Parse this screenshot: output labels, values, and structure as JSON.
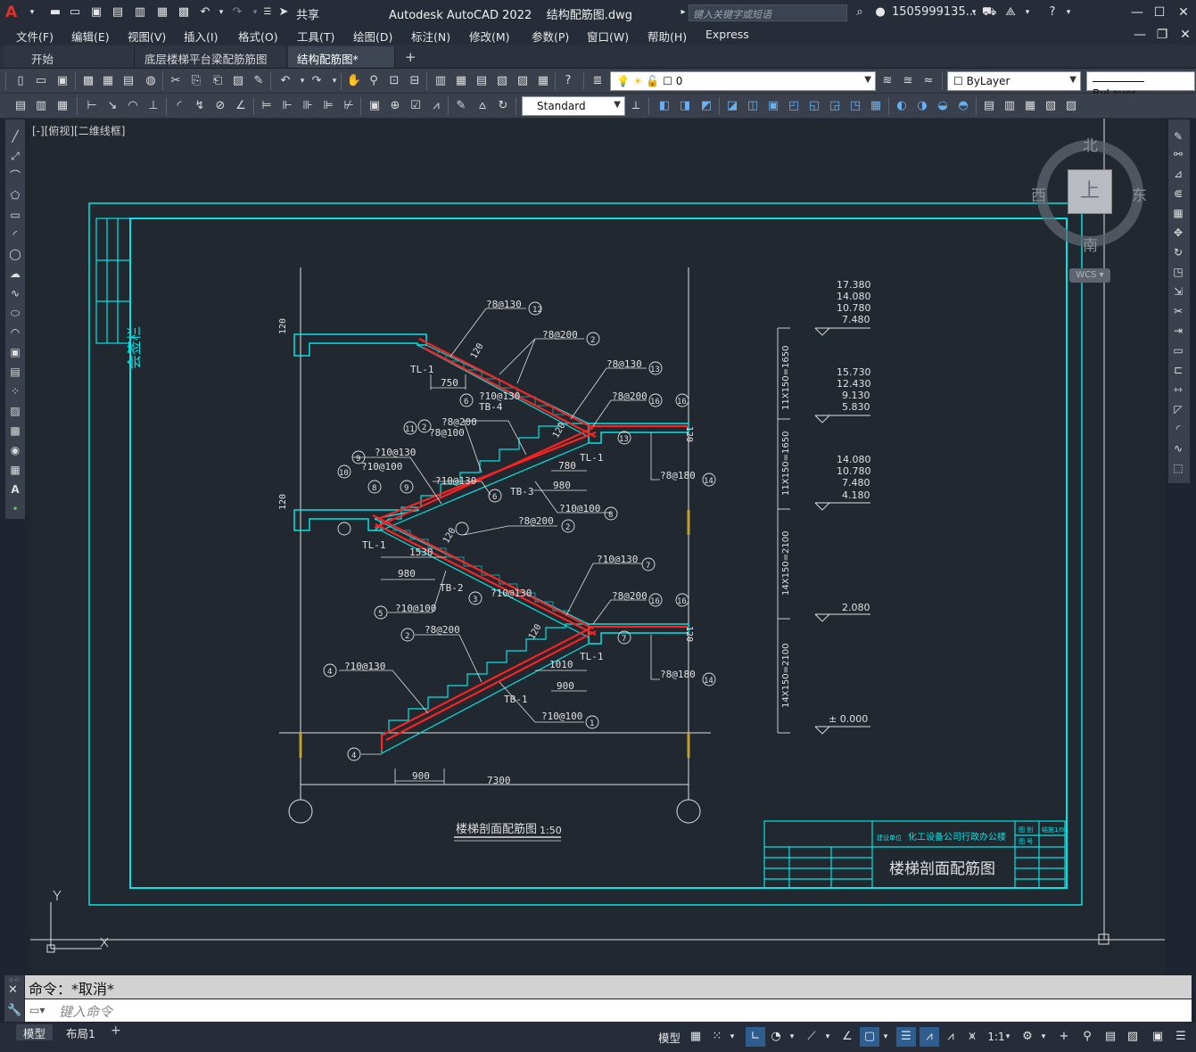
{
  "titlebar": {
    "app_logo": "A",
    "share_label": "共享",
    "app_name": "Autodesk AutoCAD 2022",
    "file_name": "结构配筋图.dwg",
    "search_placeholder": "键入关键字或短语",
    "user": "1505999135..."
  },
  "menu": [
    "文件(F)",
    "编辑(E)",
    "视图(V)",
    "插入(I)",
    "格式(O)",
    "工具(T)",
    "绘图(D)",
    "标注(N)",
    "修改(M)",
    "参数(P)",
    "窗口(W)",
    "帮助(H)",
    "Express"
  ],
  "tabs": [
    {
      "label": "开始",
      "closable": false
    },
    {
      "label": "底层楼梯平台梁配筋筋图",
      "closable": true
    },
    {
      "label": "结构配筋图*",
      "closable": true,
      "active": true
    }
  ],
  "toolbar": {
    "layer_value": "0",
    "color_value": "ByLayer",
    "linetype_value": "ByLayer",
    "textstyle_value": "Standard"
  },
  "viewport_label": "[-][俯视][二维线框]",
  "viewcube": {
    "north": "北",
    "south": "南",
    "east": "东",
    "west": "西",
    "top": "上",
    "wcs": "WCS"
  },
  "drawing": {
    "signature_column": "会签栏",
    "section_title": "楼梯剖面配筋图",
    "scale": "1:50",
    "total_dim": "7300",
    "bottom_dim": "900",
    "labels": {
      "r12": "?8@130",
      "r12_num": "12",
      "r2a": "?8@200",
      "r2a_num": "2",
      "r13a": "?8@130",
      "r13a_num": "13",
      "r16a": "?8@200",
      "r16a_num": "16",
      "r6": "?10@130",
      "r6_num": "6",
      "tb4": "TB-4",
      "r8a": "?8@200",
      "r8b": "?8@100",
      "r11_num": "11",
      "r2b_num": "2",
      "r9": "?10@130",
      "r9_num": "9",
      "r10": "?10@100",
      "r10_num": "10",
      "r8num": "8",
      "r9num2": "9",
      "r6b": "?10@130",
      "tb3": "TB-3",
      "r6b_num": "6",
      "r14a": "?8@180",
      "r14a_num": "14",
      "r8c": "?10@100",
      "r8c_num": "8",
      "tl1a": "TL-1",
      "tl1b": "TL-1",
      "tl1c": "TL-1",
      "tl1d": "TL-1",
      "d750": "750",
      "d780": "780",
      "d980a": "980",
      "d1530": "1530",
      "d980b": "980",
      "r2c": "?8@200",
      "r2c_num": "2",
      "r7a": "?10@130",
      "r7a_num": "7",
      "r16b": "?8@200",
      "r16b_num": "16",
      "tb2": "TB-2",
      "r3": "?10@130",
      "r3_num": "3",
      "r5": "?10@100",
      "r5_num": "5",
      "r2d": "?8@200",
      "r2d_num": "2",
      "r7b_num": "7",
      "r4": "?10@130",
      "r4_num": "4",
      "r4b_num": "4",
      "d1010": "1010",
      "d900": "900",
      "tb1": "TB-1",
      "r1": "?10@100",
      "r1_num": "1",
      "r14b": "?8@180",
      "r14b_num": "14",
      "r13b_num": "13",
      "h120a": "120",
      "h120b": "120",
      "h120c": "120",
      "h120d": "120",
      "d120a": "120",
      "d120b": "120",
      "d120c": "120",
      "d120d": "120"
    },
    "levels": [
      {
        "values": [
          "17.380",
          "14.080",
          "10.780",
          "7.480"
        ]
      },
      {
        "values": [
          "15.730",
          "12.430",
          "9.130",
          "5.830"
        ]
      },
      {
        "values": [
          "14.080",
          "10.780",
          "7.480",
          "4.180"
        ]
      },
      {
        "values": [
          "2.080"
        ]
      },
      {
        "values": [
          "± 0.000"
        ]
      }
    ],
    "vertical_dims": [
      "11X150=1650",
      "11X150=1650",
      "14X150=2100",
      "14X150=2100"
    ],
    "title_block": {
      "company": "化工设备公司行政办公楼",
      "drawing_name": "楼梯剖面配筋图",
      "left_tag": "建设单位",
      "right_tag1": "图 别",
      "right_tag2": "图 号",
      "right_val1": "结施1/02"
    }
  },
  "command": {
    "history": "命令：*取消*",
    "input_placeholder": "键入命令"
  },
  "status": {
    "layout_tabs": [
      "模型",
      "布局1"
    ],
    "model_label": "模型",
    "scale": "1:1"
  },
  "colors": {
    "accent_cyan": "#00e5e5",
    "rebar_red": "#ff2020",
    "drawing_white": "#e0e0e0",
    "background": "#212830"
  }
}
